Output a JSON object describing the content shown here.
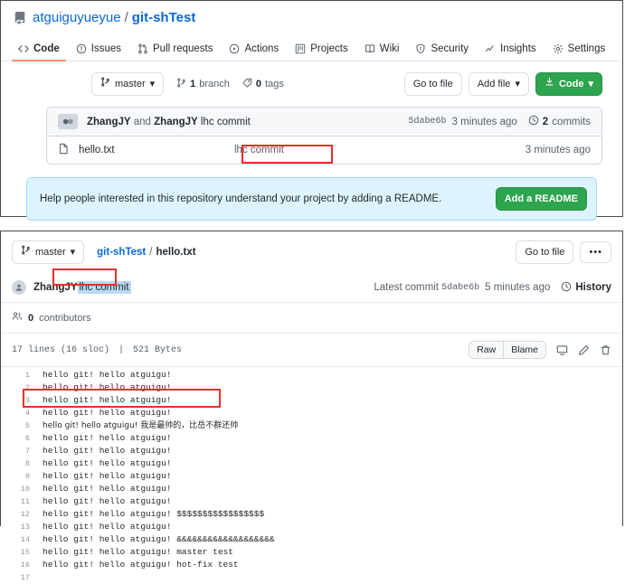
{
  "repo_panel": {
    "header": {
      "repo_icon": "repo-icon",
      "owner": "atguiguyueyue",
      "separator": "/",
      "name": "git-shTest"
    },
    "nav_tabs": [
      {
        "label": "Code",
        "icon": "code-icon",
        "selected": true
      },
      {
        "label": "Issues",
        "icon": "issue-opened-icon",
        "selected": false
      },
      {
        "label": "Pull requests",
        "icon": "git-pull-request-icon",
        "selected": false
      },
      {
        "label": "Actions",
        "icon": "play-icon",
        "selected": false
      },
      {
        "label": "Projects",
        "icon": "project-icon",
        "selected": false
      },
      {
        "label": "Wiki",
        "icon": "book-icon",
        "selected": false
      },
      {
        "label": "Security",
        "icon": "shield-icon",
        "selected": false
      },
      {
        "label": "Insights",
        "icon": "graph-icon",
        "selected": false
      },
      {
        "label": "Settings",
        "icon": "gear-icon",
        "selected": false
      }
    ],
    "branch_bar": {
      "branch_button": "master",
      "branch_count_num": "1",
      "branch_count_label": "branch",
      "tag_count_num": "0",
      "tag_count_label": "tags",
      "go_to_file": "Go to file",
      "add_file": "Add file",
      "code_button": "Code"
    },
    "commit_bar": {
      "author_1": "ZhangJY",
      "and_text": "and",
      "author_2": "ZhangJY",
      "message": "lhc commit",
      "sha": "5dabe6b",
      "time": "3 minutes ago",
      "commits_count": "2",
      "commits_label": "commits"
    },
    "file_rows": [
      {
        "name": "hello.txt",
        "message": "lhc commit",
        "time": "3 minutes ago"
      }
    ],
    "readme_banner": {
      "text": "Help people interested in this repository understand your project by adding a README.",
      "button": "Add a README"
    }
  },
  "file_panel": {
    "head": {
      "branch_button": "master",
      "breadcrumb_repo": "git-shTest",
      "breadcrumb_sep": "/",
      "breadcrumb_file": "hello.txt",
      "go_to_file": "Go to file",
      "more_button": "•••"
    },
    "commit_row": {
      "author": "ZhangJY",
      "message": "lhc commit",
      "latest_commit_label": "Latest commit",
      "sha": "5dabe6b",
      "time": "5 minutes ago",
      "history_label": "History"
    },
    "contributors": {
      "count": "0",
      "label": "contributors"
    },
    "toolbar": {
      "lines": "17 lines (16 sloc)",
      "size": "521 Bytes",
      "raw": "Raw",
      "blame": "Blame",
      "icons": [
        "desktop-download-icon",
        "pencil-icon",
        "trash-icon"
      ]
    },
    "code": [
      {
        "n": "1",
        "text": "hello git! hello atguigu!"
      },
      {
        "n": "2",
        "text": "hello git! hello atguigu!"
      },
      {
        "n": "3",
        "text": "hello git! hello atguigu!"
      },
      {
        "n": "4",
        "text": "hello git! hello atguigu!"
      },
      {
        "n": "5",
        "text": "hello git! hello atguigu! 我是最帅的，比岳不群还帅"
      },
      {
        "n": "6",
        "text": "hello git! hello atguigu!"
      },
      {
        "n": "7",
        "text": "hello git! hello atguigu!"
      },
      {
        "n": "8",
        "text": "hello git! hello atguigu!"
      },
      {
        "n": "9",
        "text": "hello git! hello atguigu!"
      },
      {
        "n": "10",
        "text": "hello git! hello atguigu!"
      },
      {
        "n": "11",
        "text": "hello git! hello atguigu!"
      },
      {
        "n": "12",
        "text": "hello git! hello atguigu! $$$$$$$$$$$$$$$$$"
      },
      {
        "n": "13",
        "text": "hello git! hello atguigu!"
      },
      {
        "n": "14",
        "text": "hello git! hello atguigu! &&&&&&&&&&&&&&&&&&&"
      },
      {
        "n": "15",
        "text": "hello git! hello atguigu! master test"
      },
      {
        "n": "16",
        "text": "hello git! hello atguigu! hot-fix test"
      },
      {
        "n": "17",
        "text": ""
      }
    ]
  },
  "annotations": {
    "color": "#e8302a",
    "boxes": [
      "repo-commit-message",
      "file-view-commit-message",
      "code-line-5"
    ]
  }
}
